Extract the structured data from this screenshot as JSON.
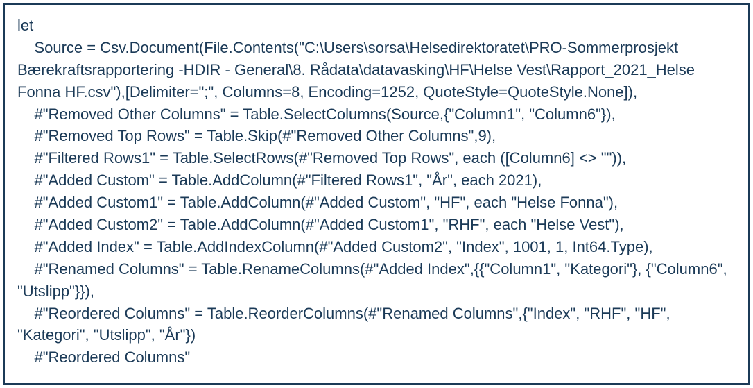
{
  "code": {
    "line1": "let",
    "line2": "    Source = Csv.Document(File.Contents(\"C:\\Users\\sorsa\\Helsedirektoratet\\PRO-Sommerprosjekt Bærekraftsrapportering -HDIR - General\\8. Rådata\\datavasking\\HF\\Helse Vest\\Rapport_2021_Helse Fonna HF.csv\"),[Delimiter=\";\", Columns=8, Encoding=1252, QuoteStyle=QuoteStyle.None]),",
    "line3": "    #\"Removed Other Columns\" = Table.SelectColumns(Source,{\"Column1\", \"Column6\"}),",
    "line4": "    #\"Removed Top Rows\" = Table.Skip(#\"Removed Other Columns\",9),",
    "line5": "    #\"Filtered Rows1\" = Table.SelectRows(#\"Removed Top Rows\", each ([Column6] <> \"\")),",
    "line6": "    #\"Added Custom\" = Table.AddColumn(#\"Filtered Rows1\", \"År\", each 2021),",
    "line7": "    #\"Added Custom1\" = Table.AddColumn(#\"Added Custom\", \"HF\", each \"Helse Fonna\"),",
    "line8": "    #\"Added Custom2\" = Table.AddColumn(#\"Added Custom1\", \"RHF\", each \"Helse Vest\"),",
    "line9": "    #\"Added Index\" = Table.AddIndexColumn(#\"Added Custom2\", \"Index\", 1001, 1, Int64.Type),",
    "line10": "    #\"Renamed Columns\" = Table.RenameColumns(#\"Added Index\",{{\"Column1\", \"Kategori\"}, {\"Column6\", \"Utslipp\"}}),",
    "line11": "    #\"Reordered Columns\" = Table.ReorderColumns(#\"Renamed Columns\",{\"Index\", \"RHF\", \"HF\", \"Kategori\", \"Utslipp\", \"År\"})",
    "line12": "    #\"Reordered Columns\""
  }
}
